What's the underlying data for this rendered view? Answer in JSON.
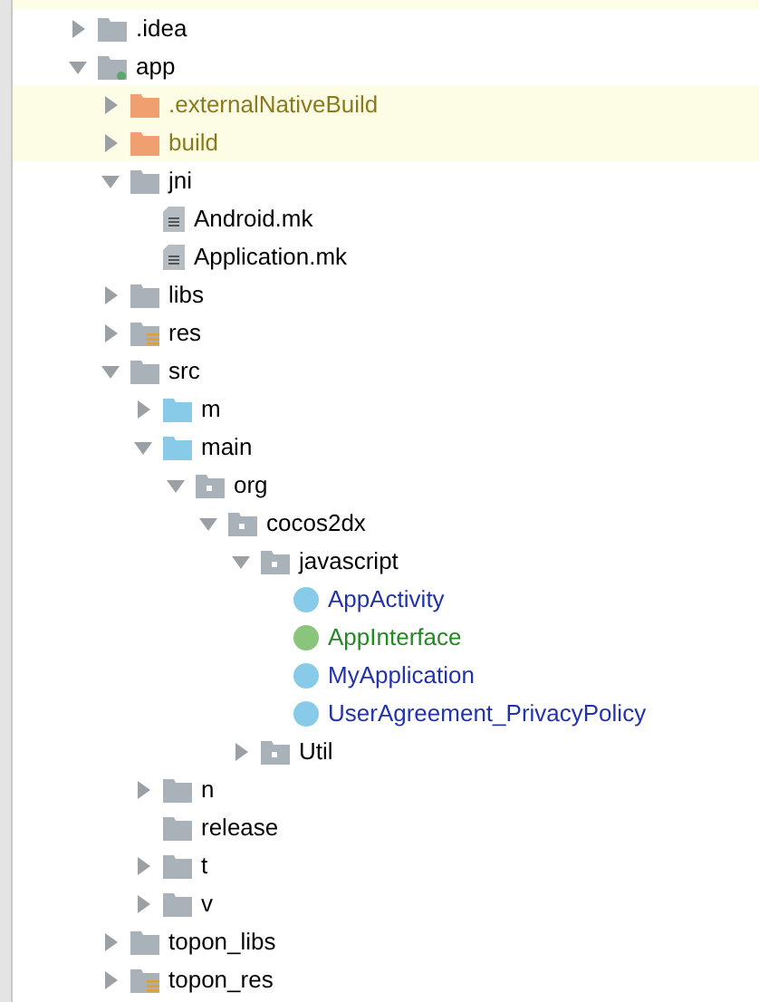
{
  "tree": [
    {
      "name": ".idea",
      "kind": "folder",
      "expanded": false,
      "highlighted": false
    },
    {
      "name": "app",
      "kind": "module",
      "expanded": true,
      "highlighted": false,
      "children": [
        {
          "name": ".externalNativeBuild",
          "kind": "excluded",
          "expanded": false,
          "highlighted": true
        },
        {
          "name": "build",
          "kind": "excluded",
          "expanded": false,
          "highlighted": true
        },
        {
          "name": "jni",
          "kind": "folder",
          "expanded": true,
          "highlighted": false,
          "children": [
            {
              "name": "Android.mk",
              "kind": "file",
              "highlighted": false
            },
            {
              "name": "Application.mk",
              "kind": "file",
              "highlighted": false
            }
          ]
        },
        {
          "name": "libs",
          "kind": "folder",
          "expanded": false,
          "highlighted": false
        },
        {
          "name": "res",
          "kind": "resources",
          "expanded": false,
          "highlighted": false
        },
        {
          "name": "src",
          "kind": "folder",
          "expanded": true,
          "highlighted": false,
          "children": [
            {
              "name": "m",
              "kind": "source",
              "expanded": false,
              "highlighted": false
            },
            {
              "name": "main",
              "kind": "source",
              "expanded": true,
              "highlighted": false,
              "children": [
                {
                  "name": "org",
                  "kind": "package",
                  "expanded": true,
                  "highlighted": false,
                  "children": [
                    {
                      "name": "cocos2dx",
                      "kind": "package",
                      "expanded": true,
                      "highlighted": false,
                      "children": [
                        {
                          "name": "javascript",
                          "kind": "package",
                          "expanded": true,
                          "highlighted": false,
                          "children": [
                            {
                              "name": "AppActivity",
                              "kind": "class",
                              "highlighted": false
                            },
                            {
                              "name": "AppInterface",
                              "kind": "interface",
                              "highlighted": false
                            },
                            {
                              "name": "MyApplication",
                              "kind": "class",
                              "highlighted": false
                            },
                            {
                              "name": "UserAgreement_PrivacyPolicy",
                              "kind": "class",
                              "highlighted": false
                            }
                          ]
                        },
                        {
                          "name": "Util",
                          "kind": "package",
                          "expanded": false,
                          "highlighted": false
                        }
                      ]
                    }
                  ]
                }
              ]
            },
            {
              "name": "n",
              "kind": "folder",
              "expanded": false,
              "highlighted": false
            },
            {
              "name": "release",
              "kind": "folder",
              "highlighted": false
            },
            {
              "name": "t",
              "kind": "folder",
              "expanded": false,
              "highlighted": false
            },
            {
              "name": "v",
              "kind": "folder",
              "expanded": false,
              "highlighted": false
            }
          ]
        },
        {
          "name": "topon_libs",
          "kind": "folder",
          "expanded": false,
          "highlighted": false
        },
        {
          "name": "topon_res",
          "kind": "resources",
          "expanded": false,
          "highlighted": false
        }
      ]
    }
  ]
}
